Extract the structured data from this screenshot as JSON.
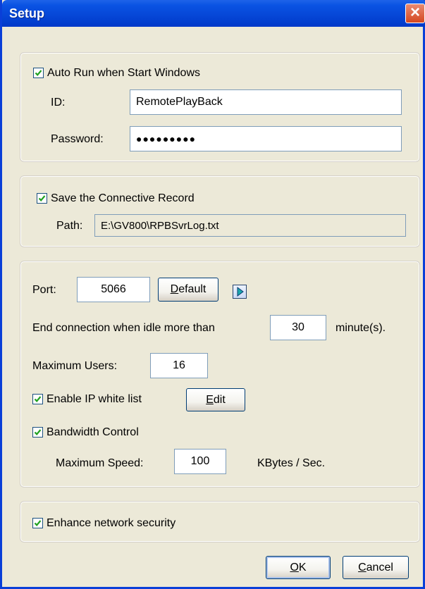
{
  "window": {
    "title": "Setup"
  },
  "login_group": {
    "auto_run_label": "Auto Run when Start Windows",
    "auto_run_checked": true,
    "id_label": "ID:",
    "id_value": "RemotePlayBack",
    "password_label": "Password:",
    "password_masked": "●●●●●●●●●"
  },
  "record_group": {
    "save_label": "Save the Connective Record",
    "save_checked": true,
    "path_label": "Path:",
    "path_value": "E:\\GV800\\RPBSvrLog.txt"
  },
  "network_group": {
    "port_label": "Port:",
    "port_value": "5066",
    "default_button": "Default",
    "idle_label": "End connection when idle more than",
    "idle_value": "30",
    "idle_unit": "minute(s).",
    "max_users_label": "Maximum Users:",
    "max_users_value": "16",
    "whitelist_label": "Enable IP white list",
    "whitelist_checked": true,
    "edit_button": "Edit",
    "bandwidth_label": "Bandwidth Control",
    "bandwidth_checked": true,
    "max_speed_label": "Maximum Speed:",
    "max_speed_value": "100",
    "max_speed_unit": "KBytes / Sec."
  },
  "security_group": {
    "enhance_label": "Enhance network security",
    "enhance_checked": true
  },
  "footer": {
    "ok_button": "OK",
    "cancel_button": "Cancel"
  },
  "icons": {
    "close": "close-icon",
    "checkbox": "check-icon",
    "arrow": "play-arrow-icon"
  },
  "colors": {
    "titlebar": "#0a53e3",
    "close_button": "#d5471f",
    "dialog_bg": "#ece9d8",
    "field_border": "#7f9db9",
    "check_mark": "#21a121"
  }
}
